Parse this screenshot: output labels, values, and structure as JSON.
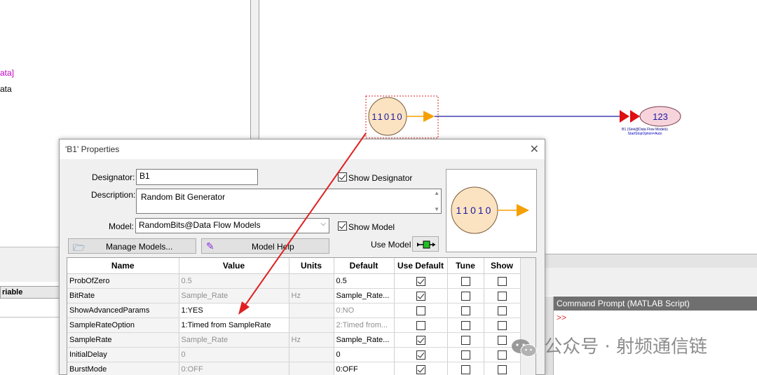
{
  "background": {
    "left_text_1": "ata]",
    "left_text_2": "ata",
    "variable_header": "riable",
    "command_prompt_title": "Command Prompt (MATLAB Script)",
    "command_prompt_symbol": ">>"
  },
  "schematic": {
    "source_bits_label": "11010",
    "sink_value_label": "123",
    "sink_caption_1": "B1 (Sink@Data Flow Models)",
    "sink_caption_2": "StartStopOption=Auto"
  },
  "dialog": {
    "title": "'B1' Properties",
    "close_glyph": "✕",
    "designator_label": "Designator:",
    "designator_value": "B1",
    "show_designator_label": "Show Designator",
    "show_designator_checked": true,
    "description_label": "Description:",
    "description_value": "Random Bit Generator",
    "model_label": "Model:",
    "model_value": "RandomBits@Data Flow Models",
    "show_model_label": "Show Model",
    "show_model_checked": true,
    "manage_models_label": "Manage Models...",
    "model_help_label": "Model Help",
    "use_model_label": "Use Model",
    "preview_bits_label": "11010",
    "grid": {
      "headers": [
        "Name",
        "Value",
        "Units",
        "Default",
        "Use Default",
        "Tune",
        "Show"
      ],
      "rows": [
        {
          "name": "ProbOfZero",
          "value": "0.5",
          "units": "",
          "default": "0.5",
          "use_default": true,
          "tune": false,
          "show": false,
          "active": false,
          "default_grey": false
        },
        {
          "name": "BitRate",
          "value": "Sample_Rate",
          "units": "Hz",
          "default": "Sample_Rate...",
          "use_default": true,
          "tune": false,
          "show": false,
          "active": false,
          "default_grey": false
        },
        {
          "name": "ShowAdvancedParams",
          "value": "1:YES",
          "units": "",
          "default": "0:NO",
          "use_default": false,
          "tune": false,
          "show": false,
          "active": true,
          "default_grey": true
        },
        {
          "name": "SampleRateOption",
          "value": "1:Timed from SampleRate",
          "units": "",
          "default": "2:Timed from...",
          "use_default": false,
          "tune": false,
          "show": false,
          "active": true,
          "default_grey": true
        },
        {
          "name": "SampleRate",
          "value": "Sample_Rate",
          "units": "Hz",
          "default": "Sample_Rate...",
          "use_default": true,
          "tune": false,
          "show": false,
          "active": false,
          "default_grey": false
        },
        {
          "name": "InitialDelay",
          "value": "0",
          "units": "",
          "default": "0",
          "use_default": true,
          "tune": false,
          "show": false,
          "active": false,
          "default_grey": false
        },
        {
          "name": "BurstMode",
          "value": "0:OFF",
          "units": "",
          "default": "0:OFF",
          "use_default": true,
          "tune": false,
          "show": false,
          "active": false,
          "default_grey": false
        }
      ]
    }
  },
  "watermark": {
    "text": "公众号 · 射频通信链"
  },
  "colors": {
    "bit_circle_fill": "#fbe3c2",
    "arrow_orange": "#f5a000",
    "wire_blue": "#1a1aa0",
    "sink_red": "#e01010",
    "sink_fill": "#f7d4dc",
    "annotation_red": "#e02020"
  }
}
